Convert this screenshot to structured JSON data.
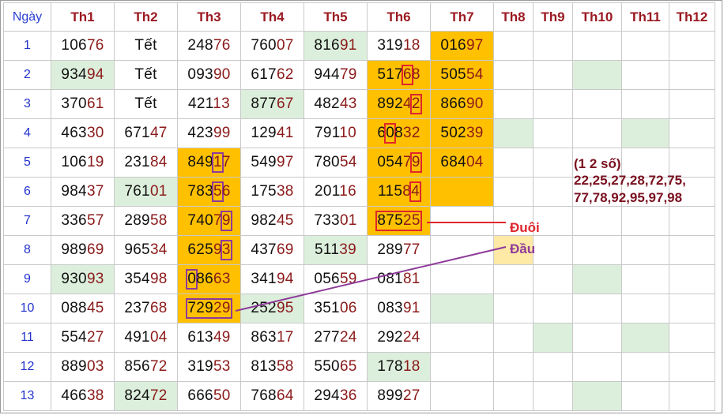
{
  "headers": [
    "Ngày",
    "Th1",
    "Th2",
    "Th3",
    "Th4",
    "Th5",
    "Th6",
    "Th7",
    "Th8",
    "Th9",
    "Th10",
    "Th11",
    "Th12"
  ],
  "rows": [
    {
      "day": "1",
      "cells": [
        "10676",
        "Tết",
        "24876",
        "76007",
        "81691",
        "31918",
        "01697"
      ]
    },
    {
      "day": "2",
      "cells": [
        "93494",
        "Tết",
        "09390",
        "61762",
        "94479",
        "51768",
        "50554"
      ]
    },
    {
      "day": "3",
      "cells": [
        "37061",
        "Tết",
        "42113",
        "87767",
        "48243",
        "89242",
        "86690"
      ]
    },
    {
      "day": "4",
      "cells": [
        "46330",
        "67147",
        "42399",
        "12941",
        "79110",
        "60832",
        "50239"
      ]
    },
    {
      "day": "5",
      "cells": [
        "10619",
        "23184",
        "84917",
        "54997",
        "78054",
        "05479",
        "68404"
      ]
    },
    {
      "day": "6",
      "cells": [
        "98437",
        "76101",
        "78356",
        "17538",
        "20116",
        "11584",
        ""
      ]
    },
    {
      "day": "7",
      "cells": [
        "33657",
        "28958",
        "74079",
        "98245",
        "73301",
        "87525",
        ""
      ]
    },
    {
      "day": "8",
      "cells": [
        "98969",
        "96534",
        "62593",
        "43769",
        "51139",
        "28977",
        ""
      ]
    },
    {
      "day": "9",
      "cells": [
        "93093",
        "35498",
        "08663",
        "34194",
        "05659",
        "08181",
        ""
      ]
    },
    {
      "day": "10",
      "cells": [
        "08845",
        "23768",
        "72929",
        "25295",
        "35106",
        "08391",
        ""
      ]
    },
    {
      "day": "11",
      "cells": [
        "55427",
        "49104",
        "61349",
        "86317",
        "27724",
        "29224",
        ""
      ]
    },
    {
      "day": "12",
      "cells": [
        "88903",
        "85672",
        "31953",
        "81358",
        "55065",
        "17818",
        ""
      ]
    },
    {
      "day": "13",
      "cells": [
        "46638",
        "82472",
        "66650",
        "76864",
        "29436",
        "89927",
        ""
      ]
    }
  ],
  "annotations": {
    "duoi": "Đuôi",
    "dau": "Đầu",
    "note_title": "(1 2 số)",
    "note_line1": "22,25,27,28,72,75,",
    "note_line2": "77,78,92,95,97,98"
  },
  "colors": {
    "green": "#dcefdc",
    "orange": "#ffc000",
    "light_yellow": "#ffe9a6",
    "header_text": "#9b1a22",
    "day_text": "#2233cc",
    "red_box": "#e0262e",
    "purple_box": "#8e3a9a"
  }
}
